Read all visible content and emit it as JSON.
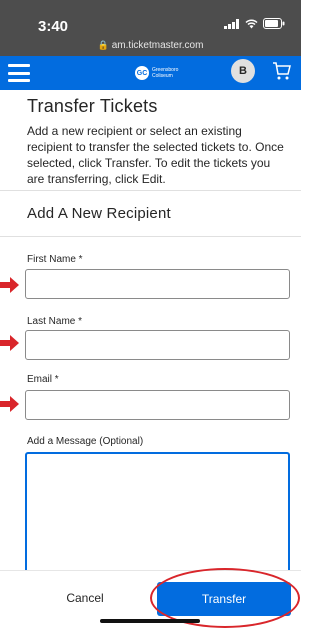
{
  "status": {
    "time": "3:40",
    "url": "am.ticketmaster.com"
  },
  "nav": {
    "brand_initials": "GC",
    "brand_name": "Greensboro Coliseum",
    "avatar_initial": "B"
  },
  "page": {
    "title": "Transfer Tickets",
    "intro": "Add a new recipient or select an existing recipient to transfer the selected tickets to. Once selected, click Transfer. To edit the tickets you are transferring, click Edit."
  },
  "form": {
    "section_title": "Add A New Recipient",
    "first_name_label": "First Name *",
    "first_name_value": "",
    "last_name_label": "Last Name *",
    "last_name_value": "",
    "email_label": "Email *",
    "email_value": "",
    "message_label": "Add a Message (Optional)",
    "message_value": ""
  },
  "footer": {
    "cancel_label": "Cancel",
    "transfer_label": "Transfer"
  },
  "colors": {
    "brand_blue": "#026cdf",
    "annotation_red": "#d9262b",
    "status_bar": "#4d4d4d"
  },
  "icons": [
    "signal-icon",
    "wifi-icon",
    "battery-icon",
    "lock-icon",
    "menu-icon",
    "cart-icon",
    "arrow-icon"
  ]
}
